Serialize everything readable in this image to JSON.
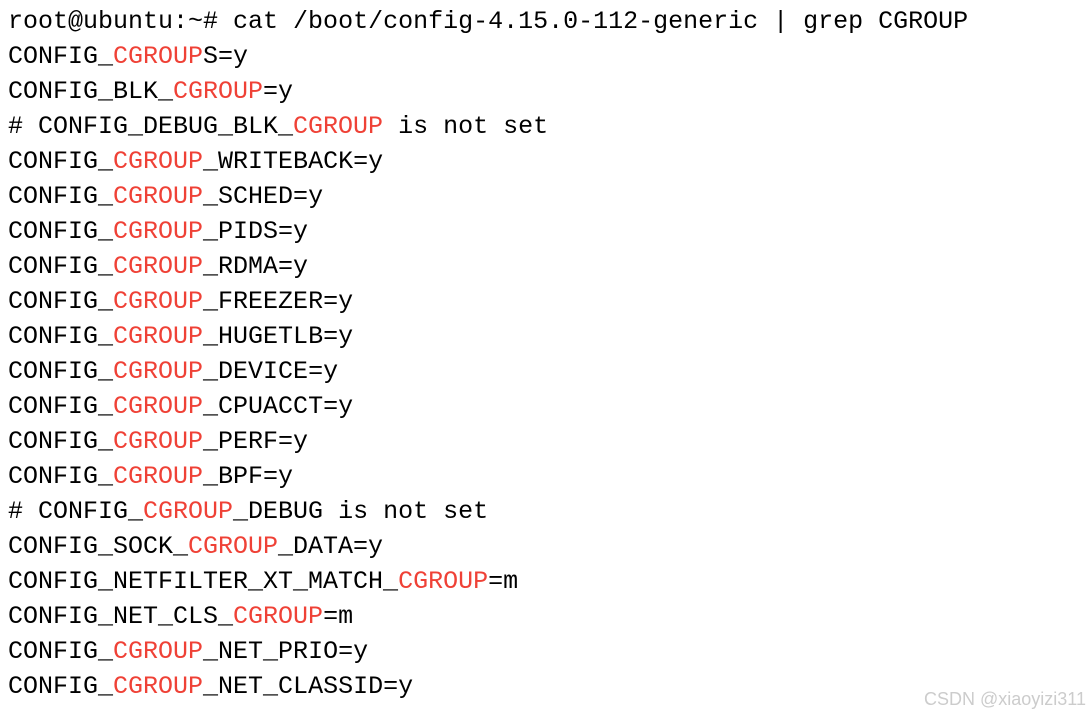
{
  "terminal": {
    "prompt": "root@ubuntu:~# ",
    "command": "cat /boot/config-4.15.0-112-generic | grep CGROUP",
    "lines": [
      {
        "segments": [
          {
            "t": "CONFIG_"
          },
          {
            "t": "CGROUP",
            "hl": true
          },
          {
            "t": "S=y"
          }
        ]
      },
      {
        "segments": [
          {
            "t": "CONFIG_BLK_"
          },
          {
            "t": "CGROUP",
            "hl": true
          },
          {
            "t": "=y"
          }
        ]
      },
      {
        "segments": [
          {
            "t": "# CONFIG_DEBUG_BLK_"
          },
          {
            "t": "CGROUP",
            "hl": true
          },
          {
            "t": " is not set"
          }
        ]
      },
      {
        "segments": [
          {
            "t": "CONFIG_"
          },
          {
            "t": "CGROUP",
            "hl": true
          },
          {
            "t": "_WRITEBACK=y"
          }
        ]
      },
      {
        "segments": [
          {
            "t": "CONFIG_"
          },
          {
            "t": "CGROUP",
            "hl": true
          },
          {
            "t": "_SCHED=y"
          }
        ]
      },
      {
        "segments": [
          {
            "t": "CONFIG_"
          },
          {
            "t": "CGROUP",
            "hl": true
          },
          {
            "t": "_PIDS=y"
          }
        ]
      },
      {
        "segments": [
          {
            "t": "CONFIG_"
          },
          {
            "t": "CGROUP",
            "hl": true
          },
          {
            "t": "_RDMA=y"
          }
        ]
      },
      {
        "segments": [
          {
            "t": "CONFIG_"
          },
          {
            "t": "CGROUP",
            "hl": true
          },
          {
            "t": "_FREEZER=y"
          }
        ]
      },
      {
        "segments": [
          {
            "t": "CONFIG_"
          },
          {
            "t": "CGROUP",
            "hl": true
          },
          {
            "t": "_HUGETLB=y"
          }
        ]
      },
      {
        "segments": [
          {
            "t": "CONFIG_"
          },
          {
            "t": "CGROUP",
            "hl": true
          },
          {
            "t": "_DEVICE=y"
          }
        ]
      },
      {
        "segments": [
          {
            "t": "CONFIG_"
          },
          {
            "t": "CGROUP",
            "hl": true
          },
          {
            "t": "_CPUACCT=y"
          }
        ]
      },
      {
        "segments": [
          {
            "t": "CONFIG_"
          },
          {
            "t": "CGROUP",
            "hl": true
          },
          {
            "t": "_PERF=y"
          }
        ]
      },
      {
        "segments": [
          {
            "t": "CONFIG_"
          },
          {
            "t": "CGROUP",
            "hl": true
          },
          {
            "t": "_BPF=y"
          }
        ]
      },
      {
        "segments": [
          {
            "t": "# CONFIG_"
          },
          {
            "t": "CGROUP",
            "hl": true
          },
          {
            "t": "_DEBUG is not set"
          }
        ]
      },
      {
        "segments": [
          {
            "t": "CONFIG_SOCK_"
          },
          {
            "t": "CGROUP",
            "hl": true
          },
          {
            "t": "_DATA=y"
          }
        ]
      },
      {
        "segments": [
          {
            "t": "CONFIG_NETFILTER_XT_MATCH_"
          },
          {
            "t": "CGROUP",
            "hl": true
          },
          {
            "t": "=m"
          }
        ]
      },
      {
        "segments": [
          {
            "t": "CONFIG_NET_CLS_"
          },
          {
            "t": "CGROUP",
            "hl": true
          },
          {
            "t": "=m"
          }
        ]
      },
      {
        "segments": [
          {
            "t": "CONFIG_"
          },
          {
            "t": "CGROUP",
            "hl": true
          },
          {
            "t": "_NET_PRIO=y"
          }
        ]
      },
      {
        "segments": [
          {
            "t": "CONFIG_"
          },
          {
            "t": "CGROUP",
            "hl": true
          },
          {
            "t": "_NET_CLASSID=y"
          }
        ]
      }
    ]
  },
  "watermark": "CSDN @xiaoyizi311"
}
